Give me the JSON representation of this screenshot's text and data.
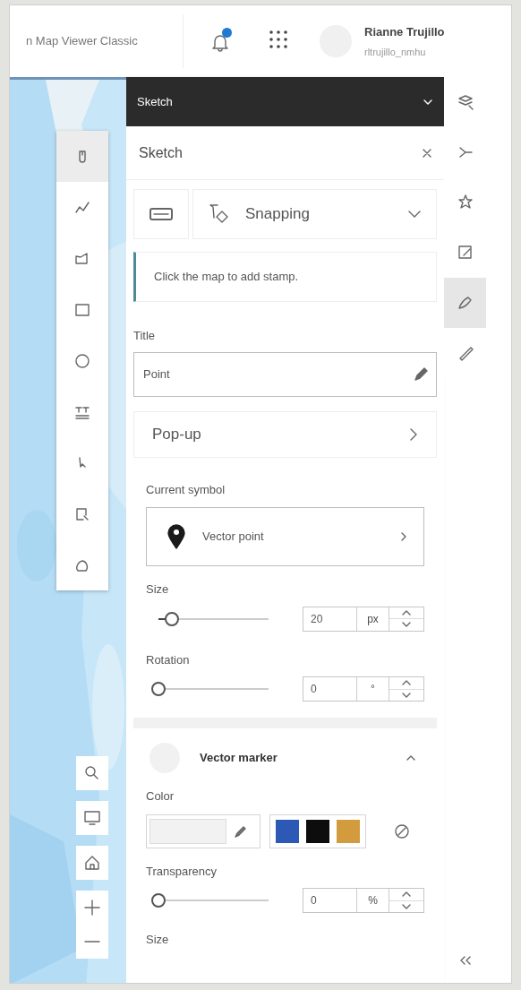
{
  "header": {
    "app_title": "n Map Viewer Classic",
    "notification_badge": true,
    "user_name": "Rianne Trujillo",
    "user_id": "rltrujillo_nmhu"
  },
  "map_tools": [
    {
      "kind": "point",
      "selected": true
    },
    {
      "kind": "polyline",
      "selected": false
    },
    {
      "kind": "polygon",
      "selected": false
    },
    {
      "kind": "rectangle",
      "selected": false
    },
    {
      "kind": "circle",
      "selected": false
    },
    {
      "kind": "text",
      "selected": false
    },
    {
      "kind": "select",
      "selected": false
    },
    {
      "kind": "lasso-select",
      "selected": false
    },
    {
      "kind": "freehand",
      "selected": false
    }
  ],
  "map_controls": [
    {
      "kind": "search"
    },
    {
      "kind": "monitor"
    },
    {
      "kind": "home"
    },
    {
      "kind": "zoom-in"
    },
    {
      "kind": "zoom-out"
    }
  ],
  "panel_bar": {
    "title": "Sketch"
  },
  "sketch": {
    "title": "Sketch",
    "snapping": "Snapping",
    "notice": "Click the map to add stamp.",
    "title_label": "Title",
    "title_value": "Point",
    "popup": "Pop-up",
    "symbol_label": "Current symbol",
    "symbol_name": "Vector point",
    "size": {
      "label": "Size",
      "level": 0.12,
      "value": "20",
      "unit": "px"
    },
    "rotation": {
      "label": "Rotation",
      "level": 0,
      "value": "0",
      "unit": "°"
    },
    "marker": {
      "title": "Vector marker",
      "expanded": true,
      "color_label": "Color",
      "swatches": [
        {
          "color": "#2b59b5"
        },
        {
          "color": "#0d0d0d"
        },
        {
          "color": "#d29c3e"
        }
      ],
      "transparency": {
        "label": "Transparency",
        "level": 0,
        "value": "0",
        "unit": "%"
      },
      "size_label": "Size"
    }
  },
  "action_bar": [
    {
      "kind": "layers",
      "selected": false
    },
    {
      "kind": "arrow",
      "selected": false
    },
    {
      "kind": "star",
      "selected": false
    },
    {
      "kind": "note",
      "selected": false
    },
    {
      "kind": "sketch",
      "selected": true
    },
    {
      "kind": "ruler",
      "selected": false
    }
  ]
}
